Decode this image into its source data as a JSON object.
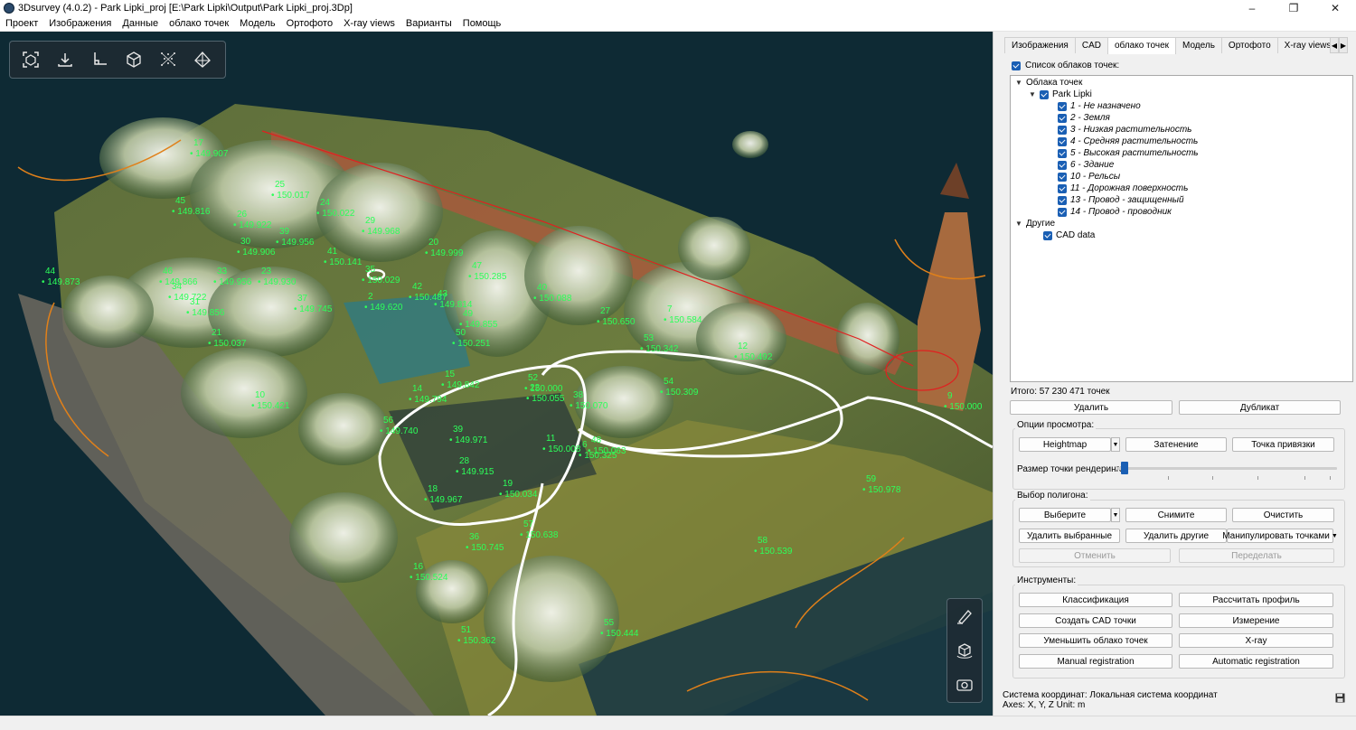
{
  "window": {
    "title": "3Dsurvey (4.0.2) - Park Lipki_proj [E:\\Park Lipki\\Output\\Park Lipki_proj.3Dp]",
    "minimize": "–",
    "maximize": "❐",
    "close": "✕"
  },
  "menu": [
    "Проект",
    "Изображения",
    "Данные",
    "облако точек",
    "Модель",
    "Ортофото",
    "X-ray views",
    "Варианты",
    "Помощь"
  ],
  "viewport": {
    "labels": [
      [
        "17",
        "149.907"
      ],
      [
        "25",
        "150.017"
      ],
      [
        "26",
        "149.922"
      ],
      [
        "45",
        "149.816"
      ],
      [
        "24",
        "150.022"
      ],
      [
        "29",
        "149.968"
      ],
      [
        "20",
        "149.999"
      ],
      [
        "46",
        "149.866"
      ],
      [
        "33",
        "149.956"
      ],
      [
        "41",
        "150.141"
      ],
      [
        "30",
        "149.906"
      ],
      [
        "44",
        "149.873"
      ],
      [
        "23",
        "149.930"
      ],
      [
        "39",
        "149.956"
      ],
      [
        "34",
        "149.722"
      ],
      [
        "47",
        "150.285"
      ],
      [
        "37",
        "149.745"
      ],
      [
        "31",
        "149.856"
      ],
      [
        "21",
        "150.037"
      ],
      [
        "40",
        "150.088"
      ],
      [
        "35",
        "150.029"
      ],
      [
        "2",
        "149.620"
      ],
      [
        "42",
        "150.487"
      ],
      [
        "43",
        "149.814"
      ],
      [
        "49",
        "149.855"
      ],
      [
        "50",
        "150.251"
      ],
      [
        "22",
        "150.055"
      ],
      [
        "27",
        "150.650"
      ],
      [
        "7",
        "150.584"
      ],
      [
        "53",
        "150.342"
      ],
      [
        "12",
        "150.492"
      ],
      [
        "10",
        "150.421"
      ],
      [
        "15",
        "149.842"
      ],
      [
        "14",
        "149.794"
      ],
      [
        "38",
        "150.070"
      ],
      [
        "52",
        "150.000"
      ],
      [
        "54",
        "150.309"
      ],
      [
        "56",
        "149.740"
      ],
      [
        "39",
        "149.971"
      ],
      [
        "48",
        "150.063"
      ],
      [
        "11",
        "150.008"
      ],
      [
        "6",
        "150.325"
      ],
      [
        "28",
        "149.915"
      ],
      [
        "18",
        "149.967"
      ],
      [
        "19",
        "150.034"
      ],
      [
        "57",
        "150.638"
      ],
      [
        "36",
        "150.745"
      ],
      [
        "16",
        "150.524"
      ],
      [
        "58",
        "150.539"
      ],
      [
        "59",
        "150.978"
      ],
      [
        "9",
        "150.000"
      ],
      [
        "55",
        "150.444"
      ],
      [
        "51",
        "150.362"
      ]
    ]
  },
  "tabs": [
    "Изображения",
    "CAD",
    "облако точек",
    "Модель",
    "Ортофото",
    "X-ray views",
    "В"
  ],
  "cloud_list": {
    "header": "Список облаков точек:",
    "root": "Облака точек",
    "project": "Park Lipki",
    "classes": [
      "1 - Не назначено",
      "2 - Земля",
      "3 - Низкая растительность",
      "4 - Средняя растительность",
      "5 - Высокая растительность",
      "6 - Здание",
      "10 - Рельсы",
      "11 - Дорожная поверхность",
      "13 - Провод - защищенный",
      "14 - Провод - проводник"
    ],
    "others": "Другие",
    "cad": "CAD data",
    "total": "Итого: 57 230 471 точек",
    "delete": "Удалить",
    "duplicate": "Дубликат"
  },
  "view_options": {
    "title": "Опции просмотра:",
    "heightmap": "Heightmap",
    "shading": "Затенение",
    "snap": "Точка привязки",
    "point_size_label": "Размер точки рендеринга:",
    "point_size_value": 0.02
  },
  "polygon": {
    "title": "Выбор полигона:",
    "select": "Выберите",
    "deselect": "Снимите",
    "clear": "Очистить",
    "delete_selected": "Удалить выбранные",
    "delete_others": "Удалить другие",
    "manipulate": "Манипулировать точками",
    "undo": "Отменить",
    "redo": "Переделать"
  },
  "tools": {
    "title": "Инструменты:",
    "buttons": [
      "Классификация",
      "Рассчитать профиль",
      "Создать CAD точки",
      "Измерение",
      "Уменьшить облако точек",
      "X-ray",
      "Manual registration",
      "Automatic registration"
    ]
  },
  "status": {
    "crs": "Система координат: Локальная система координат",
    "axes": "Axes: X, Y, Z Unit: m"
  },
  "colors": {
    "label_green": "#2dff5a",
    "accent": "#1a5fb4",
    "viewport_bg": "#0e2a34"
  }
}
